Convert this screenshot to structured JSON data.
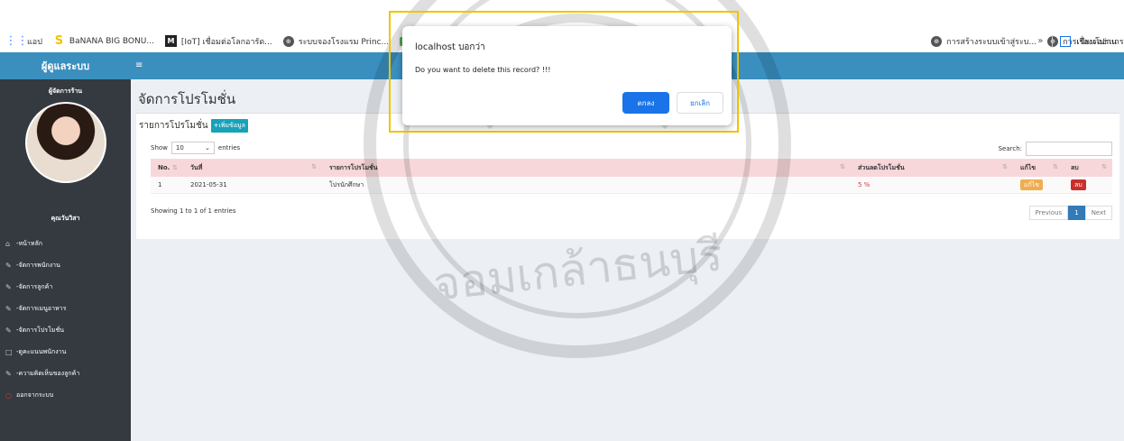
{
  "bookmarks": {
    "items": [
      {
        "label": "แอป",
        "icon": "apps-grid-icon"
      },
      {
        "label": "BaNANA BIG BONU...",
        "icon": "banana-logo-icon"
      },
      {
        "label": "[IoT] เชื่อมต่อโลกอารัด...",
        "icon": "medium-m-icon"
      },
      {
        "label": "ระบบจองโรงแรม Princ...",
        "icon": "globe-icon"
      },
      {
        "label": "",
        "icon": "green-tab-icon"
      },
      {
        "label": "การสร้างระบบเข้าสู่ระบ...",
        "icon": "globe-icon"
      },
      {
        "label": "การเขียนโปรแกรมควบ...",
        "icon": "globe-icon"
      }
    ],
    "more": "»",
    "reading_list": "เรื่องรออ่าน"
  },
  "sidebar": {
    "brand": "ผู้ดูแลระบบ",
    "role": "ผู้จัดการร้าน",
    "name": "คุณวันวิสา",
    "menu": [
      {
        "label": "-หน้าหลัก",
        "icon": "home-icon"
      },
      {
        "label": "-จัดการพนักงาน",
        "icon": "edit-icon"
      },
      {
        "label": "-จัดการลูกค้า",
        "icon": "edit-icon"
      },
      {
        "label": "-จัดการเมนูอาหาร",
        "icon": "edit-icon"
      },
      {
        "label": "-จัดการโปรโมชั่น",
        "icon": "edit-icon"
      },
      {
        "label": "-ดูคะแนนพนักงาน",
        "icon": "square-icon"
      },
      {
        "label": "-ความคิดเห็นของลูกค้า",
        "icon": "edit-icon"
      },
      {
        "label": "ออกจากระบบ",
        "icon": "logout-circle-icon"
      }
    ]
  },
  "navbar": {
    "menu_icon": "≡"
  },
  "main": {
    "title": "จัดการโปรโมชั่น",
    "card_title": "รายการโปรโมชั่น",
    "add_button": "+เพิ่มข้อมูล",
    "show_label": "Show",
    "show_value": "10",
    "entries_label": "entries",
    "search_label": "Search:",
    "columns": [
      "No.",
      "วันที่",
      "รายการโปรโมชั่น",
      "ส่วนลดโปรโมชั่น",
      "แก้ไข",
      "ลบ"
    ],
    "rows": [
      {
        "no": "1",
        "date": "2021-05-31",
        "promo": "โปรนักศึกษา",
        "discount": "5 %",
        "edit": "แก้ไข",
        "delete": "ลบ"
      }
    ],
    "info": "Showing 1 to 1 of 1 entries",
    "pager": {
      "previous": "Previous",
      "current": "1",
      "next": "Next"
    }
  },
  "dialog": {
    "title": "localhost บอกว่า",
    "message": "Do you want to delete this record? !!!",
    "ok": "ตกลง",
    "cancel": "ยกเลิก"
  },
  "watermark": {
    "text": "จอมเกล้าธนบุรี"
  }
}
